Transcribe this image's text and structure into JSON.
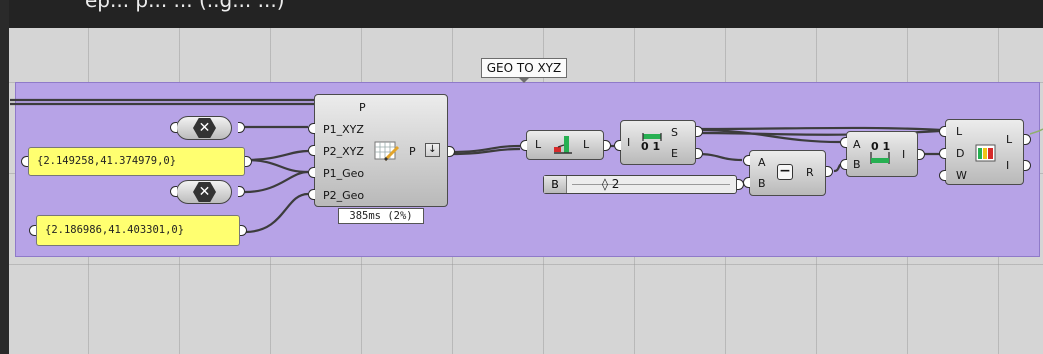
{
  "top_text": "ep... p... ... (..g... ...)",
  "group": {
    "label": "GEO TO XYZ",
    "color": "#b7a3e7"
  },
  "panels": [
    {
      "value": "{2.149258,41.374979,0}"
    },
    {
      "value": "{2.186986,41.403301,0}"
    }
  ],
  "toggles": [
    {
      "glyph": "✕"
    },
    {
      "glyph": "✕"
    }
  ],
  "main_component": {
    "inputs": [
      "P",
      "P1_XYZ",
      "P2_XYZ",
      "P1_Geo",
      "P2_Geo"
    ],
    "output": "P",
    "timing": "385ms (2%)",
    "icon": "map-grid-pencil-icon",
    "menu_glyph": "↓"
  },
  "list_item_comp": {
    "in": "L",
    "out": "L",
    "icon": "list-item-icon"
  },
  "split_comp": {
    "in": "I",
    "outs": [
      "S",
      "E"
    ],
    "icon": "split-binary-icon",
    "icon_text": "0 1"
  },
  "subtract_comp": {
    "ins": [
      "A",
      "B"
    ],
    "out": "R",
    "glyph": "−"
  },
  "slider": {
    "label": "B",
    "value": "◊ 2"
  },
  "combine_comp": {
    "ins": [
      "A",
      "B"
    ],
    "out": "I",
    "icon": "combine-binary-icon",
    "icon_text": "0 1"
  },
  "replace_comp": {
    "ins": [
      "L",
      "D",
      "W"
    ],
    "outs": [
      "L",
      "I"
    ],
    "icon": "replace-items-icon"
  },
  "colors": {
    "canvas": "#d5d5d5",
    "wire": "#3c3c3c",
    "panel": "#ffff70"
  }
}
